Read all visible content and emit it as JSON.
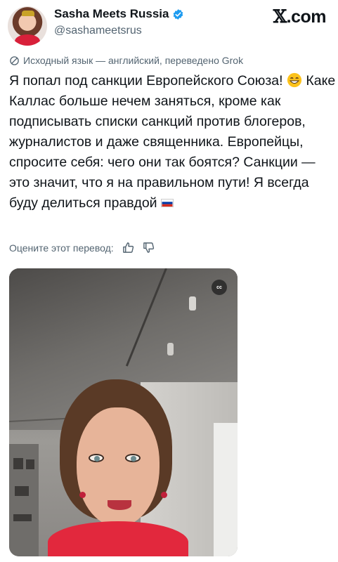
{
  "author": {
    "display_name": "Sasha Meets Russia",
    "handle": "@sashameetsrus"
  },
  "brand": {
    "x_glyph": "𝕏",
    "suffix": ".com"
  },
  "translation": {
    "note": "Исходный язык — английский, переведено Grok",
    "rate_label": "Оцените этот перевод:"
  },
  "tweet": {
    "text": "Я попал под санкции Европейского Союза!",
    "text_2": "Каке Каллас больше нечем заняться, кроме как подписывать списки санкций против блогеров, журналистов и даже священника. Европейцы, спросите себя: чего они так боятся? Санкции — это значит, что я на правильном пути! Я всегда буду делиться правдой"
  },
  "video": {
    "cc_label": "cc"
  },
  "icons": {
    "verified": "verified-badge-icon",
    "translate": "translate-icon",
    "emoji": "grinning-face-emoji-icon",
    "flag": "russia-flag-icon",
    "thumbs_up": "thumbs-up-icon",
    "thumbs_down": "thumbs-down-icon"
  },
  "colors": {
    "verified": "#1d9bf0",
    "secondary_text": "#536471",
    "primary_text": "#0f1419"
  }
}
